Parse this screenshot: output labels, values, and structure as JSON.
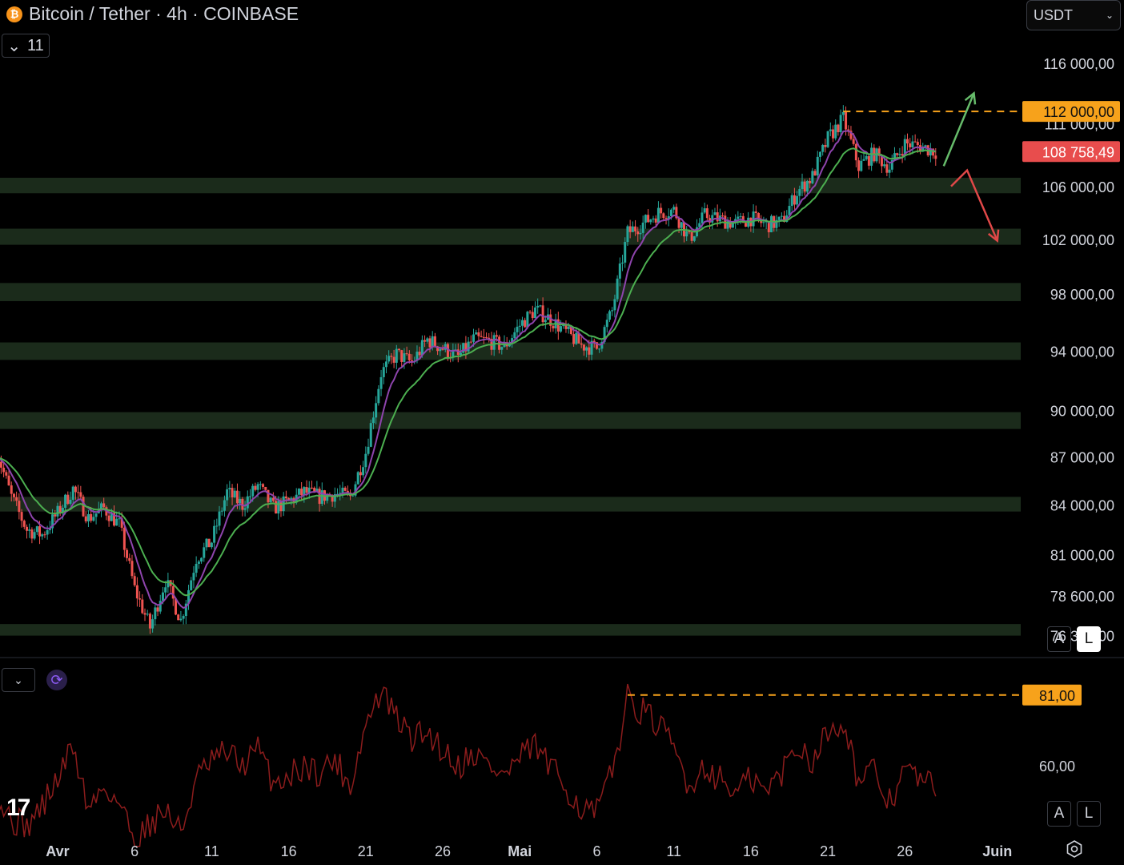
{
  "header": {
    "coin_glyph": "₿",
    "title": "Bitcoin / Tether · 4h · COINBASE",
    "indicators_count": "11",
    "currency": "USDT"
  },
  "buttons": {
    "auto": "A",
    "log": "L"
  },
  "colors": {
    "background": "#000000",
    "candle_up": "#26a69a",
    "candle_down": "#ef5350",
    "ema_fast": "#8e44ad",
    "ema_slow": "#4caf50",
    "zone": "#1b2b1b",
    "orange": "#f7a21b",
    "last_price": "#e84d4d",
    "rsi_line": "#8b1c1c"
  },
  "chart_data": {
    "type": "candlestick",
    "y_scale": "log",
    "ylim": [
      75400,
      118000
    ],
    "y_ticks": [
      {
        "value": 116000,
        "label": "116 000,00"
      },
      {
        "value": 111000,
        "label": "111 000,00"
      },
      {
        "value": 106000,
        "label": "106 000,00"
      },
      {
        "value": 102000,
        "label": "102 000,00"
      },
      {
        "value": 98000,
        "label": "98 000,00"
      },
      {
        "value": 94000,
        "label": "94 000,00"
      },
      {
        "value": 90000,
        "label": "90 000,00"
      },
      {
        "value": 87000,
        "label": "87 000,00"
      },
      {
        "value": 84000,
        "label": "84 000,00"
      },
      {
        "value": 81000,
        "label": "81 000,00"
      },
      {
        "value": 78600,
        "label": "78 600,00"
      },
      {
        "value": 76350,
        "label": "76 350,00"
      }
    ],
    "x_ticks": [
      {
        "date": "2025-04-01",
        "label": "Avr"
      },
      {
        "date": "2025-04-06",
        "label": "6"
      },
      {
        "date": "2025-04-11",
        "label": "11"
      },
      {
        "date": "2025-04-16",
        "label": "16"
      },
      {
        "date": "2025-04-21",
        "label": "21"
      },
      {
        "date": "2025-04-26",
        "label": "26"
      },
      {
        "date": "2025-05-01",
        "label": "Mai"
      },
      {
        "date": "2025-05-06",
        "label": "6"
      },
      {
        "date": "2025-05-11",
        "label": "11"
      },
      {
        "date": "2025-05-16",
        "label": "16"
      },
      {
        "date": "2025-05-21",
        "label": "21"
      },
      {
        "date": "2025-05-26",
        "label": "26"
      },
      {
        "date": "2025-06-01",
        "label": "Juin"
      }
    ],
    "x_range": [
      "2025-03-28",
      "2025-06-02"
    ],
    "price_path": [
      [
        "2025-03-28",
        87500
      ],
      [
        "2025-03-29",
        84500
      ],
      [
        "2025-03-30",
        82500
      ],
      [
        "2025-03-31",
        82200
      ],
      [
        "2025-04-01",
        83500
      ],
      [
        "2025-04-02",
        85000
      ],
      [
        "2025-04-03",
        83200
      ],
      [
        "2025-04-04",
        83800
      ],
      [
        "2025-04-05",
        82800
      ],
      [
        "2025-04-06",
        79000
      ],
      [
        "2025-04-07",
        76800
      ],
      [
        "2025-04-08",
        79500
      ],
      [
        "2025-04-09",
        77200
      ],
      [
        "2025-04-10",
        80800
      ],
      [
        "2025-04-11",
        81800
      ],
      [
        "2025-04-12",
        84800
      ],
      [
        "2025-04-13",
        84000
      ],
      [
        "2025-04-14",
        85200
      ],
      [
        "2025-04-15",
        83800
      ],
      [
        "2025-04-16",
        84200
      ],
      [
        "2025-04-17",
        84800
      ],
      [
        "2025-04-18",
        84500
      ],
      [
        "2025-04-19",
        84700
      ],
      [
        "2025-04-20",
        84500
      ],
      [
        "2025-04-21",
        87300
      ],
      [
        "2025-04-22",
        92500
      ],
      [
        "2025-04-23",
        93800
      ],
      [
        "2025-04-24",
        93200
      ],
      [
        "2025-04-25",
        94800
      ],
      [
        "2025-04-26",
        94200
      ],
      [
        "2025-04-27",
        93600
      ],
      [
        "2025-04-28",
        94800
      ],
      [
        "2025-04-29",
        94700
      ],
      [
        "2025-04-30",
        94300
      ],
      [
        "2025-05-01",
        95800
      ],
      [
        "2025-05-02",
        96900
      ],
      [
        "2025-05-03",
        96200
      ],
      [
        "2025-05-04",
        95300
      ],
      [
        "2025-05-05",
        94400
      ],
      [
        "2025-05-06",
        94200
      ],
      [
        "2025-05-07",
        96800
      ],
      [
        "2025-05-08",
        102500
      ],
      [
        "2025-05-09",
        103200
      ],
      [
        "2025-05-10",
        104000
      ],
      [
        "2025-05-11",
        104200
      ],
      [
        "2025-05-12",
        102000
      ],
      [
        "2025-05-13",
        103800
      ],
      [
        "2025-05-14",
        103500
      ],
      [
        "2025-05-15",
        103200
      ],
      [
        "2025-05-16",
        103600
      ],
      [
        "2025-05-17",
        103100
      ],
      [
        "2025-05-18",
        103300
      ],
      [
        "2025-05-19",
        105600
      ],
      [
        "2025-05-20",
        106800
      ],
      [
        "2025-05-21",
        109800
      ],
      [
        "2025-05-22",
        111400
      ],
      [
        "2025-05-23",
        107600
      ],
      [
        "2025-05-24",
        108600
      ],
      [
        "2025-05-25",
        107500
      ],
      [
        "2025-05-26",
        109400
      ],
      [
        "2025-05-27",
        109200
      ],
      [
        "2025-05-28",
        108758
      ]
    ],
    "zones": [
      {
        "low": 105500,
        "high": 106700
      },
      {
        "low": 101600,
        "high": 102800
      },
      {
        "low": 97500,
        "high": 98800
      },
      {
        "low": 93400,
        "high": 94600
      },
      {
        "low": 88800,
        "high": 89900
      },
      {
        "low": 83600,
        "high": 84500
      },
      {
        "low": 76350,
        "high": 77000
      }
    ],
    "resistance": {
      "value": 112000,
      "label": "112 000,00",
      "from": "2025-05-22"
    },
    "last_price": {
      "value": 108758.49,
      "label": "108 758,49"
    },
    "scenario_arrows": [
      {
        "direction": "up",
        "from": [
          "2025-05-28",
          107300
        ],
        "to": [
          "2025-05-31",
          113500
        ]
      },
      {
        "direction": "down",
        "from": [
          "2025-05-29",
          104800
        ],
        "to": [
          "2025-06-01",
          101900
        ]
      }
    ],
    "rsi": {
      "ylim": [
        40,
        90
      ],
      "y_ticks": [
        {
          "value": 60,
          "label": "60,00"
        }
      ],
      "level": {
        "value": 81,
        "label": "81,00",
        "from": "2025-05-08"
      },
      "path": [
        [
          "2025-03-28",
          51
        ],
        [
          "2025-03-29",
          44
        ],
        [
          "2025-03-30",
          42
        ],
        [
          "2025-03-31",
          48
        ],
        [
          "2025-04-01",
          56
        ],
        [
          "2025-04-02",
          66
        ],
        [
          "2025-04-03",
          47
        ],
        [
          "2025-04-04",
          54
        ],
        [
          "2025-04-05",
          49
        ],
        [
          "2025-04-06",
          38
        ],
        [
          "2025-04-07",
          43
        ],
        [
          "2025-04-08",
          47
        ],
        [
          "2025-04-09",
          40
        ],
        [
          "2025-04-10",
          56
        ],
        [
          "2025-04-11",
          61
        ],
        [
          "2025-04-12",
          64
        ],
        [
          "2025-04-13",
          60
        ],
        [
          "2025-04-14",
          65
        ],
        [
          "2025-04-15",
          55
        ],
        [
          "2025-04-16",
          57
        ],
        [
          "2025-04-17",
          60
        ],
        [
          "2025-04-18",
          58
        ],
        [
          "2025-04-19",
          62
        ],
        [
          "2025-04-20",
          54
        ],
        [
          "2025-04-21",
          72
        ],
        [
          "2025-04-22",
          82
        ],
        [
          "2025-04-23",
          74
        ],
        [
          "2025-04-24",
          68
        ],
        [
          "2025-04-25",
          70
        ],
        [
          "2025-04-26",
          65
        ],
        [
          "2025-04-27",
          60
        ],
        [
          "2025-04-28",
          64
        ],
        [
          "2025-04-29",
          60
        ],
        [
          "2025-04-30",
          57
        ],
        [
          "2025-05-01",
          62
        ],
        [
          "2025-05-02",
          66
        ],
        [
          "2025-05-03",
          59
        ],
        [
          "2025-05-04",
          54
        ],
        [
          "2025-05-05",
          47
        ],
        [
          "2025-05-06",
          46
        ],
        [
          "2025-05-07",
          58
        ],
        [
          "2025-05-08",
          80
        ],
        [
          "2025-05-09",
          76
        ],
        [
          "2025-05-10",
          72
        ],
        [
          "2025-05-11",
          65
        ],
        [
          "2025-05-12",
          54
        ],
        [
          "2025-05-13",
          60
        ],
        [
          "2025-05-14",
          56
        ],
        [
          "2025-05-15",
          52
        ],
        [
          "2025-05-16",
          56
        ],
        [
          "2025-05-17",
          52
        ],
        [
          "2025-05-18",
          58
        ],
        [
          "2025-05-19",
          66
        ],
        [
          "2025-05-20",
          62
        ],
        [
          "2025-05-21",
          70
        ],
        [
          "2025-05-22",
          74
        ],
        [
          "2025-05-23",
          55
        ],
        [
          "2025-05-24",
          58
        ],
        [
          "2025-05-25",
          49
        ],
        [
          "2025-05-26",
          59
        ],
        [
          "2025-05-27",
          56
        ],
        [
          "2025-05-28",
          53
        ]
      ]
    }
  }
}
